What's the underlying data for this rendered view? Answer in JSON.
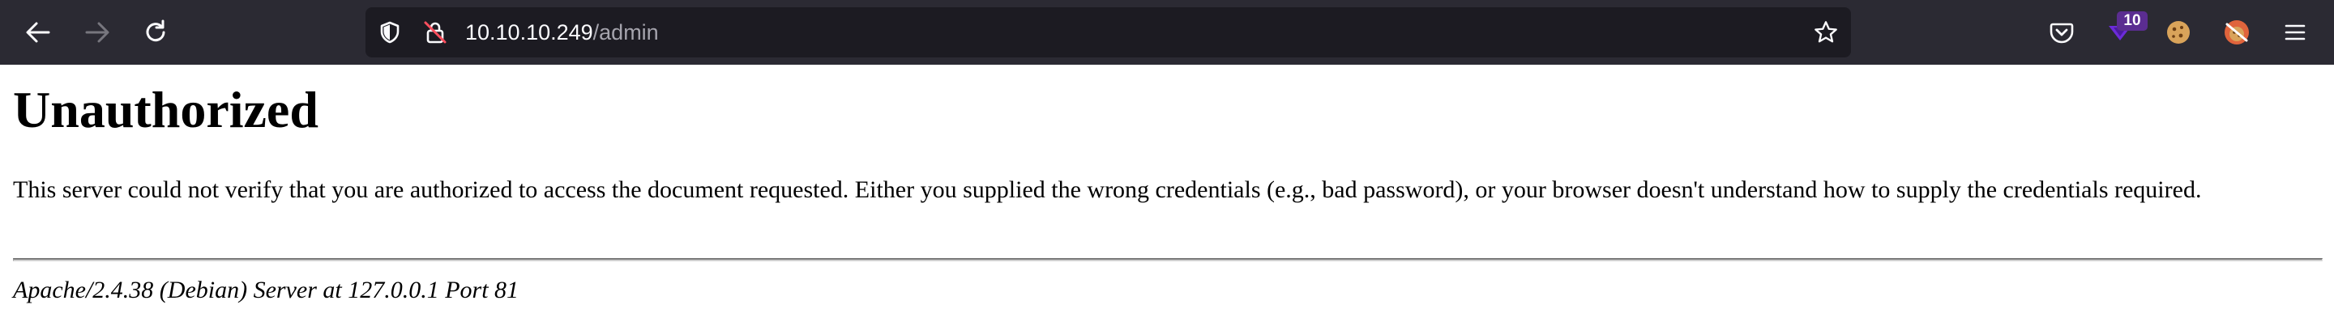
{
  "browser": {
    "url_host": "10.10.10.249",
    "url_path": "/admin",
    "extension_badge": "10",
    "icons": {
      "back": "arrow-left-icon",
      "forward": "arrow-right-icon",
      "reload": "reload-icon",
      "tracking_protection": "shield-icon",
      "connection": "insecure-lock-icon",
      "bookmark": "star-icon",
      "pocket": "pocket-icon",
      "extension_1": "purple-shield-extension-icon",
      "extension_2": "cookie-icon",
      "extension_3": "blocked-cookie-icon",
      "menu": "hamburger-menu-icon"
    }
  },
  "page": {
    "title": "Unauthorized",
    "message": "This server could not verify that you are authorized to access the document requested. Either you supplied the wrong credentials (e.g., bad password), or your browser doesn't understand how to supply the credentials required.",
    "server_signature": "Apache/2.4.38 (Debian) Server at 127.0.0.1 Port 81"
  },
  "colors": {
    "toolbar": "#2b2a33",
    "urlbar": "#1c1b22",
    "url_host": "#fbfbfe",
    "url_path": "#a5a4ad",
    "badge": "#5b2d91",
    "text": "#000000"
  }
}
